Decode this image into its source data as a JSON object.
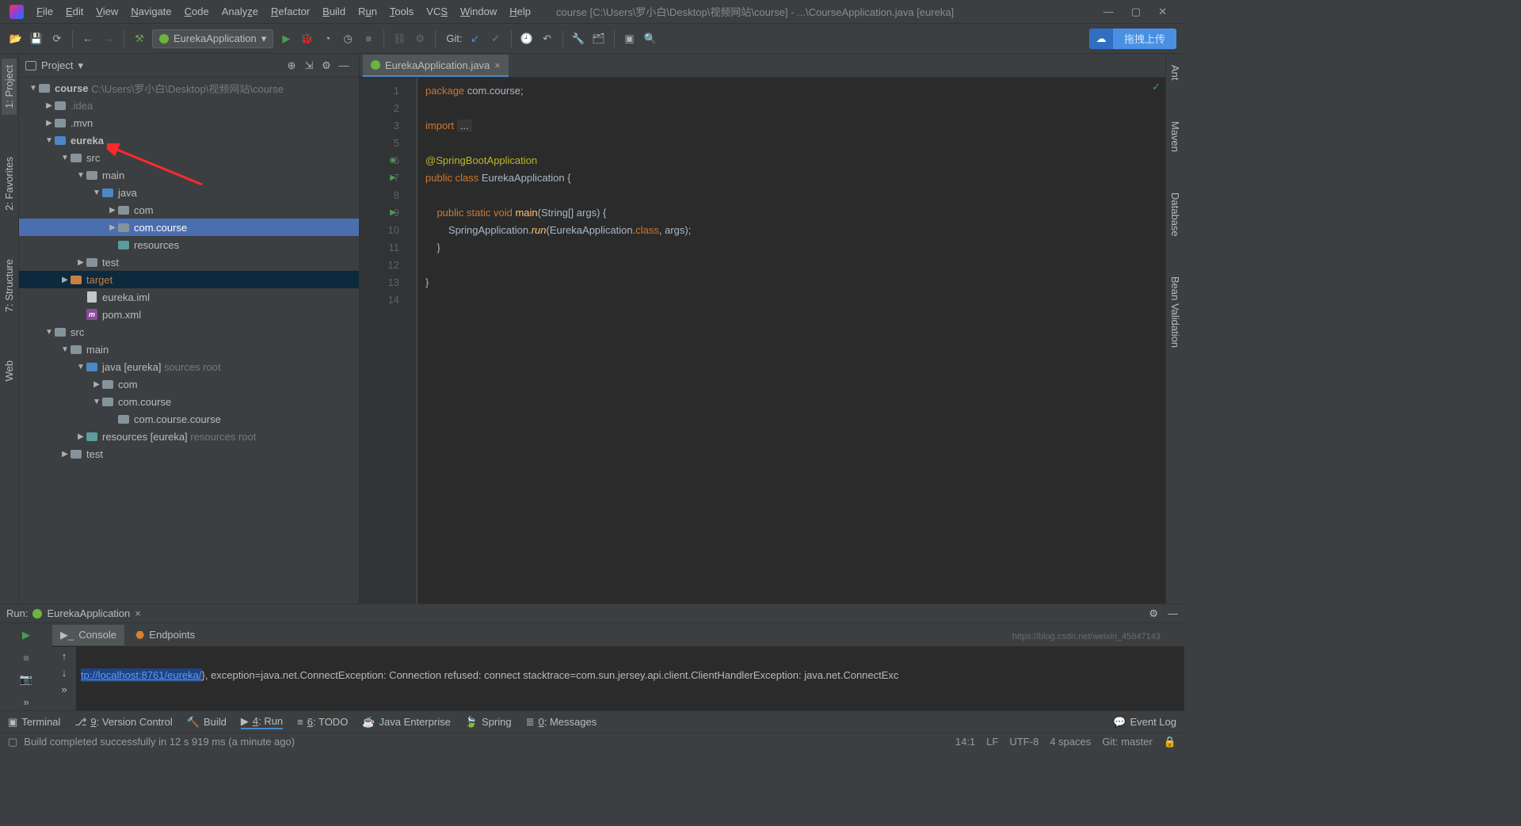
{
  "window": {
    "title": "course [C:\\Users\\罗小白\\Desktop\\视频网站\\course] - ...\\CourseApplication.java [eureka]"
  },
  "menu": {
    "items": [
      "File",
      "Edit",
      "View",
      "Navigate",
      "Code",
      "Analyze",
      "Refactor",
      "Build",
      "Run",
      "Tools",
      "VCS",
      "Window",
      "Help"
    ]
  },
  "toolbar": {
    "runConfig": "EurekaApplication",
    "gitLabel": "Git:",
    "uploadLabel": "拖拽上传"
  },
  "sidebar_left": {
    "tabs": [
      "1: Project",
      "2: Favorites",
      "7: Structure",
      "Web"
    ]
  },
  "sidebar_right": {
    "tabs": [
      "Ant",
      "Maven",
      "Database",
      "Bean Validation"
    ]
  },
  "project": {
    "header": "Project",
    "root": {
      "name": "course",
      "path": "C:\\Users\\罗小白\\Desktop\\视频网站\\course"
    },
    "tree": [
      {
        "label": ".idea"
      },
      {
        "label": ".mvn"
      },
      {
        "label": "eureka"
      },
      {
        "label": "src"
      },
      {
        "label": "main"
      },
      {
        "label": "java"
      },
      {
        "label": "com"
      },
      {
        "label": "com.course"
      },
      {
        "label": "resources"
      },
      {
        "label": "test"
      },
      {
        "label": "target"
      },
      {
        "label": "eureka.iml"
      },
      {
        "label": "pom.xml"
      },
      {
        "label": "src"
      },
      {
        "label": "main"
      },
      {
        "label": "java [eureka]",
        "hint": "sources root"
      },
      {
        "label": "com"
      },
      {
        "label": "com.course"
      },
      {
        "label": "com.course.course"
      },
      {
        "label": "resources [eureka]",
        "hint": "resources root"
      },
      {
        "label": "test"
      }
    ]
  },
  "editor": {
    "tabName": "EurekaApplication.java",
    "code": {
      "l1": {
        "pkg": "package ",
        "name": "com.course",
        ";": ";"
      },
      "l3": {
        "imp": "import ",
        "dots": "..."
      },
      "l6": {
        "ann": "@SpringBootApplication"
      },
      "l7": {
        "pub": "public ",
        "cls": "class ",
        "name": "EurekaApplication ",
        "b": "{"
      },
      "l9": {
        "ind": "    ",
        "pub": "public ",
        "stat": "static ",
        "void": "void ",
        "fn": "main",
        "args": "(String[] args) {"
      },
      "l10": {
        "ind": "        ",
        "a": "SpringApplication.",
        "run": "run",
        "b": "(EurekaApplication.",
        "cls": "class",
        "c": ", args);"
      },
      "l11": {
        "ind": "    ",
        "b": "}"
      },
      "l13": {
        "b": "}"
      }
    },
    "lineCount": 14
  },
  "run": {
    "label": "Run:",
    "config": "EurekaApplication",
    "tabs": [
      "Console",
      "Endpoints"
    ],
    "consoleLink": "tp://localhost:8761/eureka/",
    "consoleRest": "}, exception=java.net.ConnectException: Connection refused: connect stacktrace=com.sun.jersey.api.client.ClientHandlerException: java.net.ConnectExc"
  },
  "bottombar": {
    "items": [
      "Terminal",
      "9: Version Control",
      "Build",
      "4: Run",
      "6: TODO",
      "Java Enterprise",
      "Spring",
      "0: Messages"
    ],
    "eventlog": "Event Log"
  },
  "status": {
    "msg": "Build completed successfully in 12 s 919 ms (a minute ago)",
    "pos": "14:1",
    "lf": "LF",
    "enc": "UTF-8",
    "ind": "4 spaces",
    "git": "Git: master",
    "watermark": "https://blog.csdn.net/weixin_45847143"
  }
}
